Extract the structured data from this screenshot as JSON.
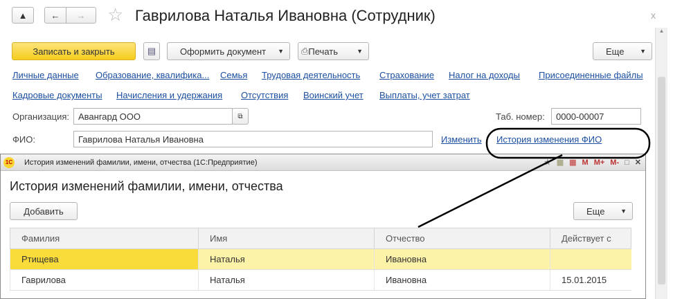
{
  "header": {
    "title": "Гаврилова Наталья Ивановна (Сотрудник)",
    "close": "x"
  },
  "toolbar": {
    "save_close": "Записать и закрыть",
    "make_doc": "Оформить документ",
    "print": "Печать",
    "more": "Еще"
  },
  "links_row1": [
    "Личные данные",
    "Образование, квалифика...",
    "Семья",
    "Трудовая деятельность",
    "Страхование",
    "Налог на доходы",
    "Присоединенные файлы"
  ],
  "links_row2": [
    "Кадровые документы",
    "Начисления и удержания",
    "Отсутствия",
    "Воинский учет",
    "Выплаты, учет затрат"
  ],
  "form": {
    "org_label": "Организация:",
    "org_value": "Авангард ООО",
    "tab_label": "Таб. номер:",
    "tab_value": "0000-00007",
    "fio_label": "ФИО:",
    "fio_value": "Гаврилова Наталья Ивановна",
    "change": "Изменить",
    "history": "История изменения ФИО"
  },
  "dialog": {
    "window_title": "История изменений фамилии, имени, отчества  (1С:Предприятие)",
    "heading": "История изменений фамилии, имени, отчества",
    "add": "Добавить",
    "more": "Еще",
    "m": "M",
    "mplus": "M+",
    "mminus": "M-",
    "columns": [
      "Фамилия",
      "Имя",
      "Отчество",
      "Действует с"
    ],
    "rows": [
      [
        "Ртищева",
        "Наталья",
        "Ивановна",
        ""
      ],
      [
        "Гаврилова",
        "Наталья",
        "Ивановна",
        "15.01.2015"
      ]
    ]
  },
  "colors": {
    "accent": "#f9d632",
    "link": "#1c4fa0",
    "selected_row": "#fdf3a8"
  }
}
